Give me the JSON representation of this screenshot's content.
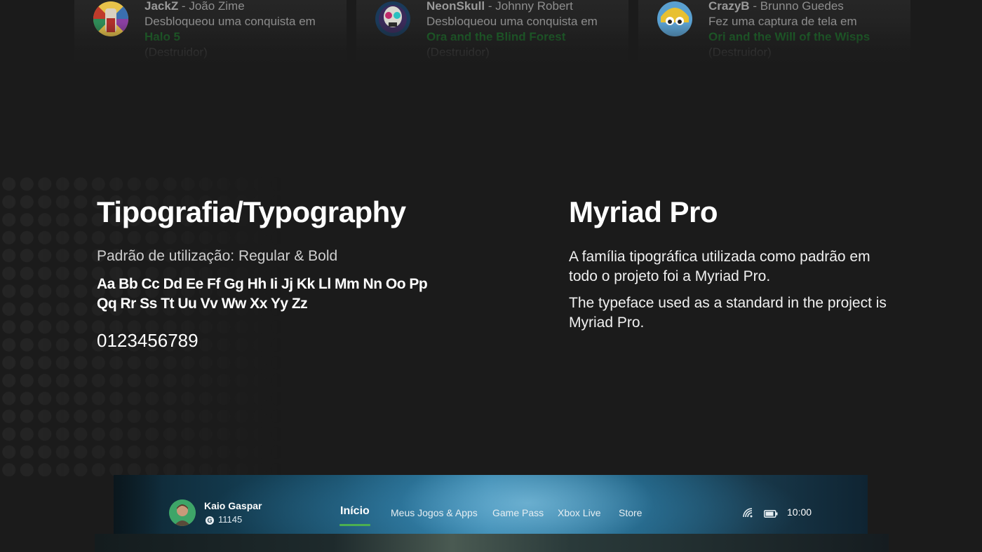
{
  "feed": [
    {
      "gamertag": "JackZ",
      "name": "João Zime",
      "action": "Desbloqueou uma conquista em",
      "game": "Halo 5",
      "detail": "(Destruidor)"
    },
    {
      "gamertag": "NeonSkull",
      "name": "Johnny Robert",
      "action": "Desbloqueou uma conquista em",
      "game": "Ora and the Blind Forest",
      "detail": "(Destruidor)"
    },
    {
      "gamertag": "CrazyB",
      "name": "Brunno Guedes",
      "action": "Fez uma captura de tela em",
      "game": "Ori and the Will of the Wisps",
      "detail": "(Destruidor)"
    }
  ],
  "typography": {
    "title": "Tipografia/Typography",
    "usage": "Padrão de utilização: Regular & Bold",
    "alphabet_line1": "Aa Bb Cc Dd Ee Ff Gg Hh Ii Jj Kk Ll Mm Nn Oo Pp",
    "alphabet_line2": "Qq Rr Ss Tt Uu Vv Ww Xx Yy Zz",
    "numbers": "0123456789"
  },
  "font_info": {
    "title": "Myriad Pro",
    "desc_pt": "A família tipográfica utilizada como padrão em todo o projeto foi a Myriad Pro.",
    "desc_en": "The typeface used as a standard in the project is Myriad Pro."
  },
  "navbar": {
    "user_name": "Kaio Gaspar",
    "gamerscore_icon": "G",
    "gamerscore": "11145",
    "items": [
      "Início",
      "Meus Jogos & Apps",
      "Game Pass",
      "Xbox Live",
      "Store"
    ],
    "active_item": "Início",
    "time": "10:00",
    "status_icons": [
      "wifi-icon",
      "battery-icon"
    ]
  },
  "colors": {
    "background": "#1b1b1b",
    "accent": "#4caf50",
    "game_link": "#1d6b2a"
  }
}
